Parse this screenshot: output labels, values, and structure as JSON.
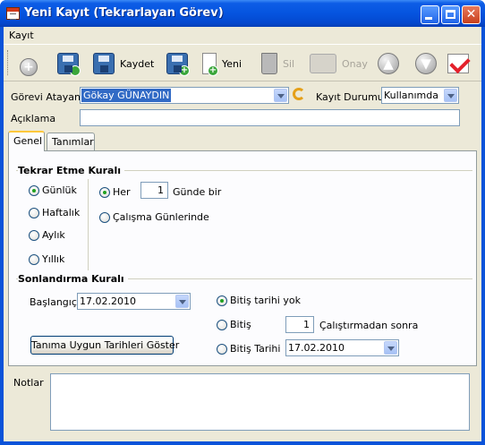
{
  "window": {
    "title": "Yeni Kayıt (Tekrarlayan Görev)",
    "close_glyph": "✕"
  },
  "menu": {
    "items": [
      "Kayıt"
    ]
  },
  "toolbar": {
    "save_label": "Kaydet",
    "new_label": "Yeni",
    "delete_label": "Sil",
    "approve_label": "Onay",
    "up_glyph": "▲",
    "down_glyph": "▼",
    "plus_glyph": "+"
  },
  "form": {
    "assigner_label": "Görevi Atayan",
    "assigner_value": "Gökay GÜNAYDIN",
    "status_label": "Kayıt Durumu",
    "status_value": "Kullanımda",
    "description_label": "Açıklama",
    "description_value": ""
  },
  "tabs": [
    "Genel",
    "Tanımlar"
  ],
  "recurrence": {
    "title": "Tekrar Etme Kuralı",
    "options": [
      "Günlük",
      "Haftalık",
      "Aylık",
      "Yıllık"
    ],
    "selected": "Günlük",
    "every_label": "Her",
    "every_value": "1",
    "every_suffix": "Günde bir",
    "workdays_label": "Çalışma Günlerinde"
  },
  "termination": {
    "title": "Sonlandırma Kuralı",
    "start_label": "Başlangıç",
    "start_value": "17.02.2010",
    "no_end_label": "Bitiş tarihi yok",
    "end_after_label": "Bitiş",
    "end_after_value": "1",
    "end_after_suffix": "Çalıştırmadan sonra",
    "end_date_label": "Bitiş Tarihi",
    "end_date_value": "17.02.2010",
    "show_dates_button": "Tanıma Uygun Tarihleri Göster"
  },
  "notes": {
    "label": "Notlar",
    "value": ""
  },
  "colors": {
    "titlebar": "#0554df",
    "face": "#ece9d8",
    "selection": "#316ac5",
    "accent": "#ffc83c"
  }
}
